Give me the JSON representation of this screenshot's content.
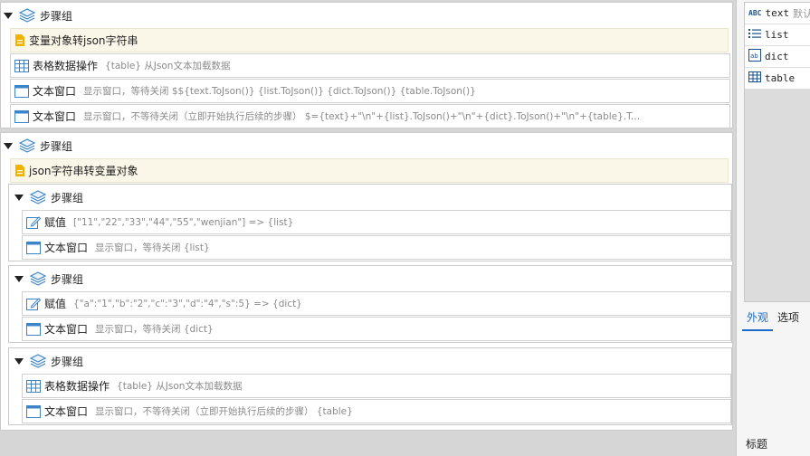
{
  "step_group_label": "步骤组",
  "group1": {
    "note": "变量对象转json字符串",
    "rows": [
      {
        "label": "表格数据操作",
        "desc": "{table} 从Json文本加载数据"
      },
      {
        "label": "文本窗口",
        "desc": "显示窗口，等待关闭 $${text.ToJson()}  {list.ToJson()}  {dict.ToJson()}  {table.ToJson()}"
      },
      {
        "label": "文本窗口",
        "desc": "显示窗口，不等待关闭（立即开始执行后续的步骤）  $={text}+\"\\n\"+{list}.ToJson()+\"\\n\"+{dict}.ToJson()+\"\\n\"+{table}.ToJ..."
      }
    ]
  },
  "group2": {
    "note": "json字符串转变量对象",
    "sub1": [
      {
        "label": "赋值",
        "desc": "[\"11\",\"22\",\"33\",\"44\",\"55\",\"wenjian\"] => {list}"
      },
      {
        "label": "文本窗口",
        "desc": "显示窗口，等待关闭 {list}"
      }
    ],
    "sub2": [
      {
        "label": "赋值",
        "desc": "{\"a\":\"1\",\"b\":\"2\",\"c\":\"3\",\"d\":\"4\",\"s\":5} => {dict}"
      },
      {
        "label": "文本窗口",
        "desc": "显示窗口，等待关闭 {dict}"
      }
    ],
    "sub3": [
      {
        "label": "表格数据操作",
        "desc": "{table} 从Json文本加载数据"
      },
      {
        "label": "文本窗口",
        "desc": "显示窗口，不等待关闭（立即开始执行后续的步骤）  {table}"
      }
    ]
  },
  "right_panel": {
    "variables": [
      {
        "name": "text",
        "extra": "默认",
        "icon": "abc-icon"
      },
      {
        "name": "list",
        "icon": "list-icon"
      },
      {
        "name": "dict",
        "icon": "dict-icon"
      },
      {
        "name": "table",
        "icon": "table-icon"
      }
    ],
    "tabs": [
      "外观",
      "选项"
    ],
    "active_tab": "外观",
    "bottom_label": "标题"
  },
  "colors": {
    "accent": "#1a6bc9",
    "note_bg": "#faf6e8",
    "icon_blue": "#3b84c9",
    "note_icon": "#f0b400"
  }
}
